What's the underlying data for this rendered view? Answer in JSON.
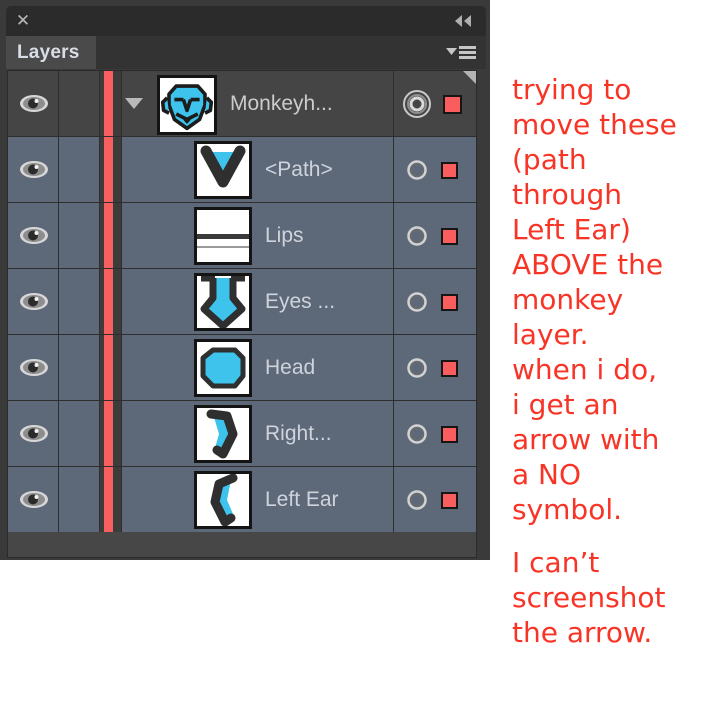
{
  "panel": {
    "title": "Layers",
    "close_icon": "close-icon",
    "collapse_icon": "double-chevron-left-icon",
    "menu_icon": "panel-menu-icon"
  },
  "layers": [
    {
      "name": "Monkeyh...",
      "is_parent": true,
      "visible": true,
      "selected": true,
      "eye_icon": "eye-icon",
      "disclosure_icon": "disclosure-triangle-down-icon",
      "thumbnail": "monkey-head-thumbnail",
      "target_icon": "target-double-circle-icon",
      "swatch_color": "#fa5d5d"
    },
    {
      "name": "<Path>",
      "is_parent": false,
      "visible": true,
      "selected": true,
      "eye_icon": "eye-icon",
      "thumbnail": "nose-path-thumbnail",
      "target_icon": "target-circle-icon",
      "swatch_color": "#fa5d5d"
    },
    {
      "name": "Lips",
      "is_parent": false,
      "visible": true,
      "selected": true,
      "eye_icon": "eye-icon",
      "thumbnail": "lips-thumbnail",
      "target_icon": "target-circle-icon",
      "swatch_color": "#fa5d5d"
    },
    {
      "name": "Eyes ...",
      "is_parent": false,
      "visible": true,
      "selected": true,
      "eye_icon": "eye-icon",
      "thumbnail": "eyes-thumbnail",
      "target_icon": "target-circle-icon",
      "swatch_color": "#fa5d5d"
    },
    {
      "name": "Head",
      "is_parent": false,
      "visible": true,
      "selected": true,
      "eye_icon": "eye-icon",
      "thumbnail": "head-thumbnail",
      "target_icon": "target-circle-icon",
      "swatch_color": "#fa5d5d"
    },
    {
      "name": "Right...",
      "is_parent": false,
      "visible": true,
      "selected": true,
      "eye_icon": "eye-icon",
      "thumbnail": "right-ear-thumbnail",
      "target_icon": "target-circle-icon",
      "swatch_color": "#fa5d5d"
    },
    {
      "name": "Left Ear",
      "is_parent": false,
      "visible": true,
      "selected": true,
      "eye_icon": "eye-icon",
      "thumbnail": "left-ear-thumbnail",
      "target_icon": "target-circle-icon",
      "swatch_color": "#fa5d5d"
    }
  ],
  "annotation": {
    "color": "#f83426",
    "lines": [
      "trying to",
      "move these",
      "(path",
      "through",
      "Left Ear)",
      "ABOVE the",
      "monkey",
      "layer.",
      "when i do,",
      "i get an",
      "arrow with",
      "a NO",
      "symbol.",
      "",
      "I can’t",
      "screenshot",
      "the arrow."
    ]
  },
  "colors": {
    "panel_background": "#3a3a3a",
    "row_selected": "#5d6879",
    "row_parent": "#454545",
    "selection_bar": "#fa5f5f",
    "artwork_cyan": "#3dc3ec",
    "artwork_outline": "#2b2b2b"
  }
}
